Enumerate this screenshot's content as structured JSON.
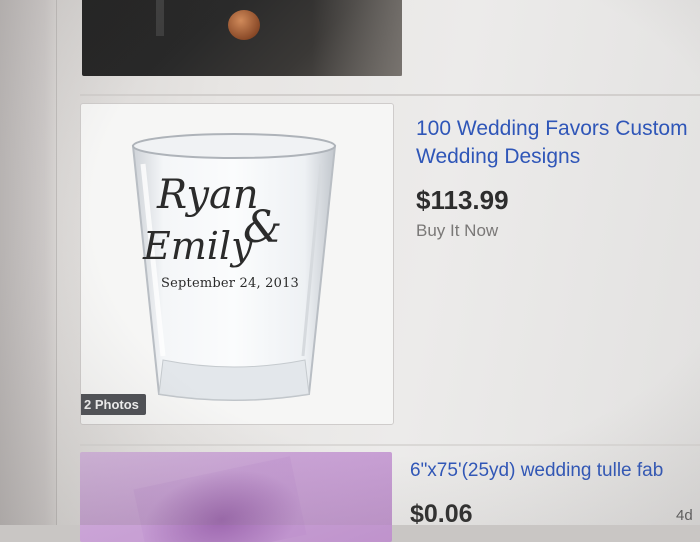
{
  "listings": [
    {
      "title_line1": "100 Wedding Favors Custom",
      "title_line2": "Wedding Designs",
      "price": "$113.99",
      "format": "Buy It Now",
      "photos_badge": "2 Photos",
      "engraving": {
        "name1": "Ryan",
        "amp": "&",
        "name2": "Emily",
        "date": "September 24, 2013"
      }
    },
    {
      "title": "6\"x75'(25yd) wedding tulle fab",
      "price": "$0.06",
      "time_left": "4d"
    }
  ],
  "colors": {
    "link": "#2f56b8",
    "price": "#2d2d2d",
    "badge_bg": "#4d4f54"
  }
}
